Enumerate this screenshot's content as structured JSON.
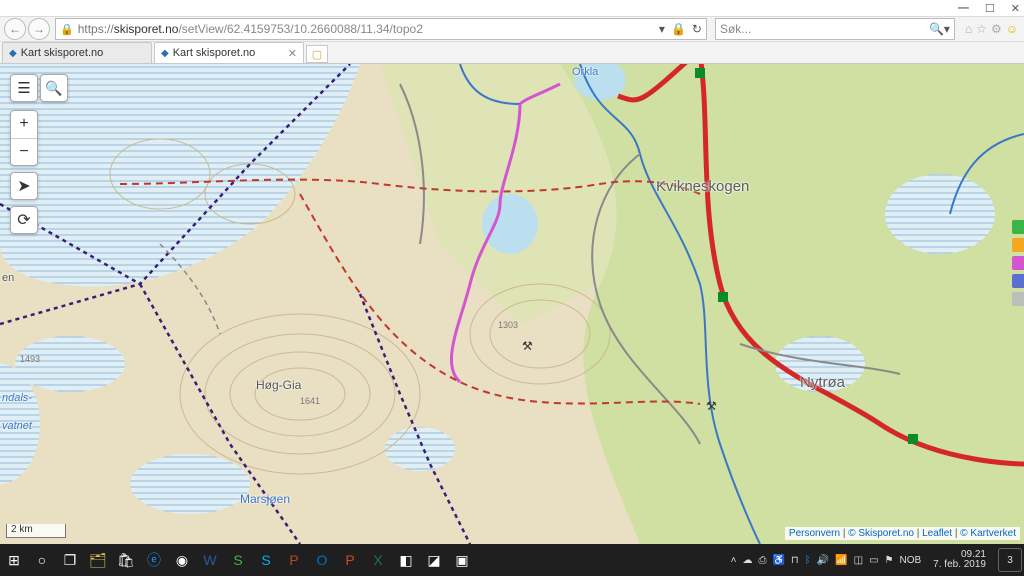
{
  "window": {
    "url_protocol": "https://",
    "url_host": "skisporet.no",
    "url_path": "/setView/62.4159753/10.2660088/11.34/topo2",
    "search_placeholder": "Søk...",
    "tabs": [
      {
        "title": "Kart skisporet.no",
        "active": false
      },
      {
        "title": "Kart skisporet.no",
        "active": true
      }
    ]
  },
  "map": {
    "scale_label": "2 km",
    "attribution": [
      "Personvern",
      "© Skisporet.no",
      "Leaflet",
      "© Kartverket"
    ],
    "labels": {
      "kvikneskogen": "Kvikneskogen",
      "nytroa": "Nytrøa",
      "hoggia": "Høg-Gia",
      "hoggia_elev": "1641",
      "marsjoen": "Marsjøen",
      "orkla": "Orkla",
      "vatnet_top": "ndals-",
      "vatnet_bot": "vatnet",
      "elev_1303": "1303",
      "elev_1493": "1493",
      "en": "en"
    },
    "layer_colors": [
      "#3bb54a",
      "#f5a623",
      "#d455d0",
      "#5b6fd0",
      "#bdbdbd"
    ]
  },
  "taskbar": {
    "lang": "NOB",
    "time": "09.21",
    "date": "7. feb. 2019",
    "notif_count": "3"
  }
}
